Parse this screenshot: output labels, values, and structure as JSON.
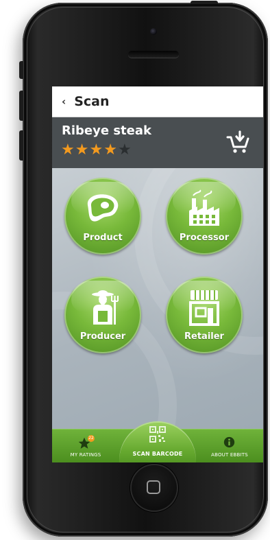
{
  "nav": {
    "back_icon": "chevron-left",
    "title": "Scan"
  },
  "product": {
    "name": "Ribeye steak",
    "rating": 4,
    "max_rating": 5,
    "cart_icon": "add-to-cart"
  },
  "buttons": [
    {
      "label": "Product",
      "icon": "steak-icon"
    },
    {
      "label": "Processor",
      "icon": "factory-icon"
    },
    {
      "label": "Producer",
      "icon": "farmer-icon"
    },
    {
      "label": "Retailer",
      "icon": "store-icon"
    }
  ],
  "tabs": {
    "ratings": {
      "label": "MY RATINGS",
      "badge": "22",
      "icon": "star-icon"
    },
    "scan": {
      "label": "SCAN BARCODE",
      "icon": "qr-code-icon"
    },
    "about": {
      "label": "ABOUT EBBITS",
      "icon": "info-icon"
    }
  },
  "colors": {
    "accent_green": "#6fb23a",
    "header_dark": "#494e51",
    "star_filled": "#f39a1f",
    "star_empty": "#2a2e30"
  }
}
